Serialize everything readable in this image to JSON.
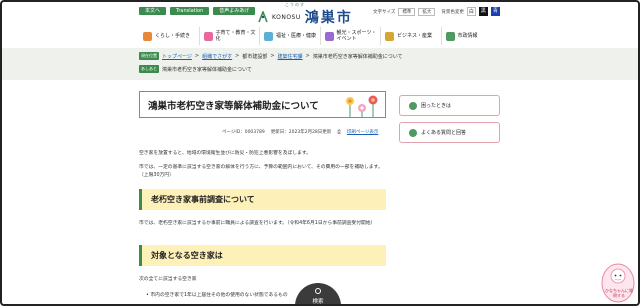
{
  "header": {
    "top_buttons": [
      "本文へ",
      "Translation",
      "音声よみあげ"
    ],
    "logo_text": "KONOSU",
    "logo_kana": "こうのす",
    "site_name": "鴻巣市",
    "util": {
      "text_size_label": "文字サイズ",
      "standard": "標準",
      "enlarge": "拡大",
      "color_label": "背景色変更",
      "white": "白",
      "black": "黒",
      "blue": "青"
    }
  },
  "nav": {
    "items": [
      {
        "label": "くらし・手続き",
        "icon": "home-icon",
        "color": "#e8893a"
      },
      {
        "label": "子育て・教育・文化",
        "icon": "child-icon",
        "color": "#e86a9c"
      },
      {
        "label": "福祉・医療・健康",
        "icon": "health-icon",
        "color": "#5ab0d6"
      },
      {
        "label": "観光・スポーツ・イベント",
        "icon": "flag-icon",
        "color": "#9a6ad0"
      },
      {
        "label": "ビジネス・産業",
        "icon": "briefcase-icon",
        "color": "#d4a735"
      },
      {
        "label": "市政情報",
        "icon": "building-icon",
        "color": "#4f9a61"
      }
    ]
  },
  "breadcrumb": {
    "tag1": "現在位置",
    "links": [
      "トップページ",
      "組織でさがす",
      "都市建設部",
      "建築住宅課"
    ],
    "current1": "鴻巣市老朽空き家等解体補助金について",
    "tag2": "あしあと",
    "current2": "鴻巣市老朽空き家等解体補助金について"
  },
  "main": {
    "title": "鴻巣市老朽空き家等解体補助金について",
    "page_id": "ページID：0003789",
    "updated": "更新日：2023年2月28日更新",
    "print": "印刷ページ表示",
    "para1": "空き家を放置すると、地域の環境衛生並びに防災・防犯上悪影響を及ぼします。",
    "para2": "市では、一定の基準に該当する空き家の解体を行う方に、予算の範囲内において、その費用の一部を補助します。（上限30万円）",
    "section1": "老朽空き家事前調査について",
    "para3": "市では、老朽空き家に該当するか事前に職員による調査を行います。（令和4年6月1日から事前調査受付開始）",
    "section2": "対象となる空き家は",
    "para4": "次の全てに該当する空き家",
    "bullet1": "市内の空き家で1年以上居住その他の使用のない状態であるもの"
  },
  "side": {
    "btn1": "困ったときは",
    "btn2": "よくある質問と回答"
  },
  "search": {
    "label": "検索"
  },
  "mascot": {
    "text": "ひなちゃんに質問する"
  }
}
